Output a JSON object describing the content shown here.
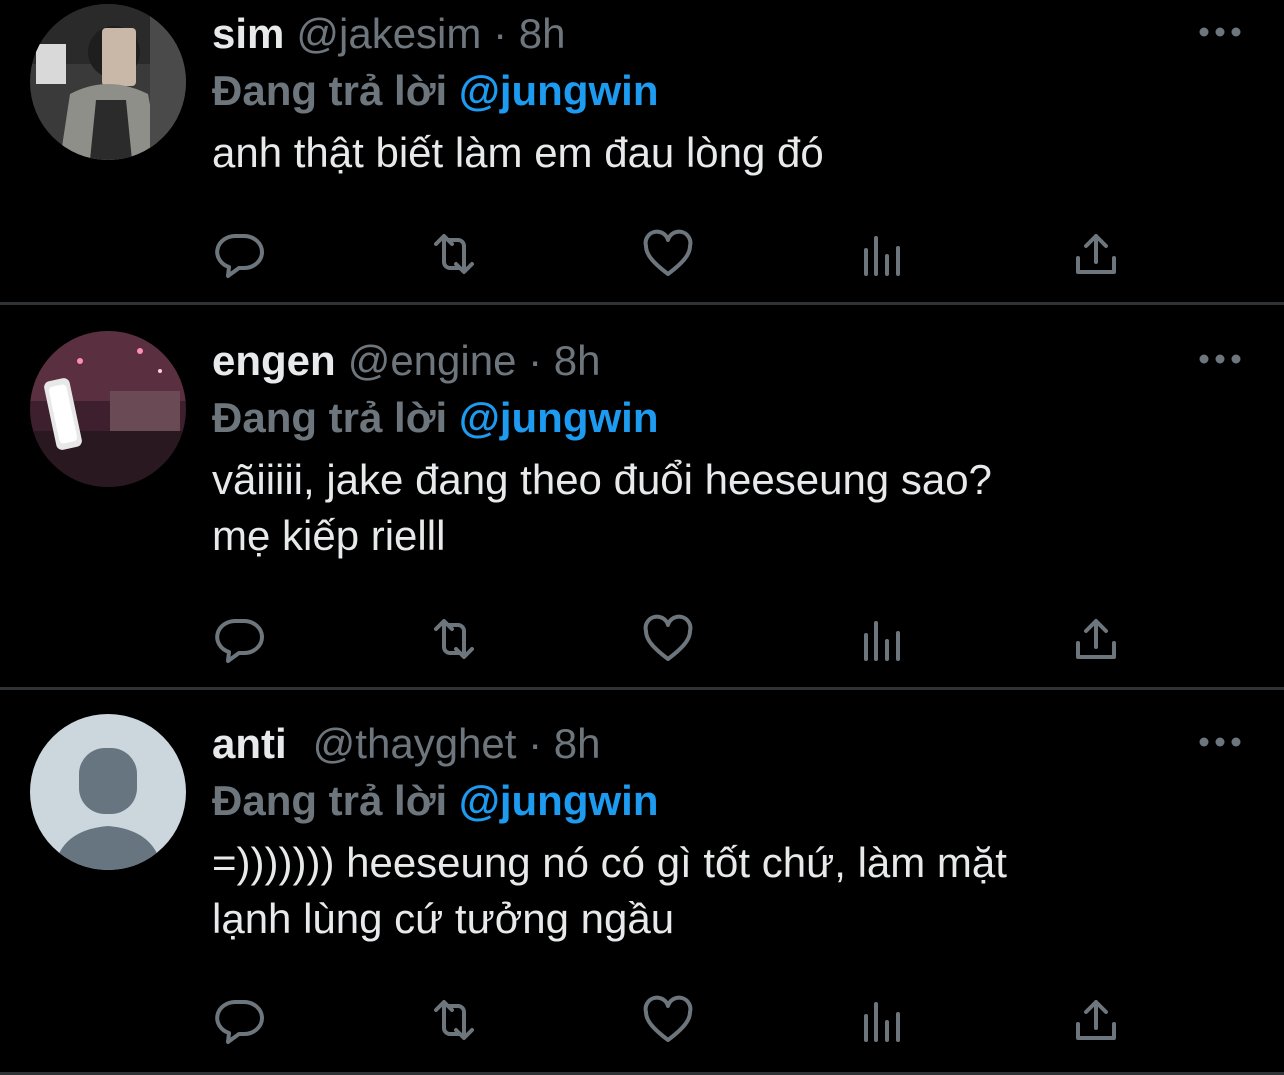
{
  "colors": {
    "background": "#000000",
    "primary_text": "#e7e9ea",
    "secondary_text": "#6e767d",
    "accent": "#1d9bf0",
    "divider": "#2f3336"
  },
  "tweets": [
    {
      "name": "sim",
      "handle": "@jakesim",
      "dot": "·",
      "time": "8h",
      "reply_prefix": "Đang trả lời",
      "reply_to": "@jungwin",
      "text": "anh thật biết làm em đau lòng đó",
      "avatar": "photo-avatar"
    },
    {
      "name": "engen",
      "handle": "@engine",
      "dot": "·",
      "time": "8h",
      "reply_prefix": "Đang trả lời",
      "reply_to": "@jungwin",
      "text": "vãiiiii, jake đang theo đuổi heeseung sao?\nmẹ kiếp rielll",
      "avatar": "concert-photo-avatar"
    },
    {
      "name": "anti",
      "handle": "@thayghet",
      "dot": "·",
      "time": "8h",
      "reply_prefix": "Đang trả lời",
      "reply_to": "@jungwin",
      "text": "=))))))) heeseung nó có gì tốt chứ, làm mặt\nlạnh lùng cứ tưởng ngầu",
      "avatar": "default-avatar"
    }
  ],
  "action_icons": [
    "reply-icon",
    "retweet-icon",
    "like-icon",
    "analytics-icon",
    "share-icon"
  ]
}
